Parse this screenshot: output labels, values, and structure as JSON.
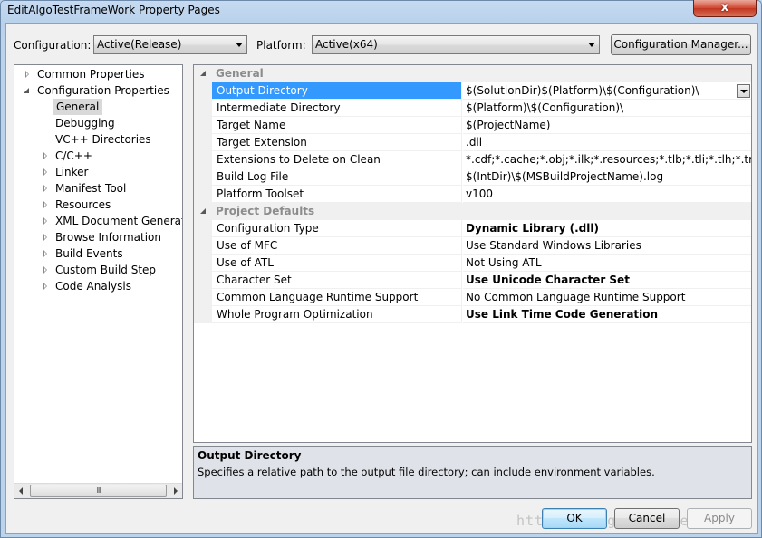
{
  "window": {
    "title": "EditAlgoTestFrameWork Property Pages",
    "close_glyph": "x"
  },
  "toolbar": {
    "configuration_label": "Configuration:",
    "configuration_value": "Active(Release)",
    "platform_label": "Platform:",
    "platform_value": "Active(x64)",
    "config_manager_button": "Configuration Manager..."
  },
  "tree": {
    "items": [
      {
        "label": "Common Properties",
        "level": 0,
        "expander": "collapsed"
      },
      {
        "label": "Configuration Properties",
        "level": 0,
        "expander": "expanded"
      },
      {
        "label": "General",
        "level": 1,
        "expander": "none",
        "selected": true
      },
      {
        "label": "Debugging",
        "level": 1,
        "expander": "none"
      },
      {
        "label": "VC++ Directories",
        "level": 1,
        "expander": "none"
      },
      {
        "label": "C/C++",
        "level": 1,
        "expander": "collapsed"
      },
      {
        "label": "Linker",
        "level": 1,
        "expander": "collapsed"
      },
      {
        "label": "Manifest Tool",
        "level": 1,
        "expander": "collapsed"
      },
      {
        "label": "Resources",
        "level": 1,
        "expander": "collapsed"
      },
      {
        "label": "XML Document Generator",
        "level": 1,
        "expander": "collapsed"
      },
      {
        "label": "Browse Information",
        "level": 1,
        "expander": "collapsed"
      },
      {
        "label": "Build Events",
        "level": 1,
        "expander": "collapsed"
      },
      {
        "label": "Custom Build Step",
        "level": 1,
        "expander": "collapsed"
      },
      {
        "label": "Code Analysis",
        "level": 1,
        "expander": "collapsed"
      }
    ],
    "scroll_thumb_grip": "III"
  },
  "grid": {
    "categories": [
      {
        "name": "General",
        "rows": [
          {
            "name": "Output Directory",
            "value": "$(SolutionDir)$(Platform)\\$(Configuration)\\",
            "selected": true
          },
          {
            "name": "Intermediate Directory",
            "value": "$(Platform)\\$(Configuration)\\"
          },
          {
            "name": "Target Name",
            "value": "$(ProjectName)"
          },
          {
            "name": "Target Extension",
            "value": ".dll"
          },
          {
            "name": "Extensions to Delete on Clean",
            "value": "*.cdf;*.cache;*.obj;*.ilk;*.resources;*.tlb;*.tli;*.tlh;*.tmp;*.rsp;*.pgc;*.pgd;*.meta;*.tlog;*.manifest;*.res;*.pch;*.exp;*.idb;*.rep;*.xdc;*.pdb;*_manifest.rc;*.bsc;*.sbr;*.xml;*.metagen;*.bi"
          },
          {
            "name": "Build Log File",
            "value": "$(IntDir)\\$(MSBuildProjectName).log"
          },
          {
            "name": "Platform Toolset",
            "value": "v100"
          }
        ]
      },
      {
        "name": "Project Defaults",
        "rows": [
          {
            "name": "Configuration Type",
            "value": "Dynamic Library (.dll)",
            "bold": true
          },
          {
            "name": "Use of MFC",
            "value": "Use Standard Windows Libraries"
          },
          {
            "name": "Use of ATL",
            "value": "Not Using ATL"
          },
          {
            "name": "Character Set",
            "value": "Use Unicode Character Set",
            "bold": true
          },
          {
            "name": "Common Language Runtime Support",
            "value": "No Common Language Runtime Support"
          },
          {
            "name": "Whole Program Optimization",
            "value": "Use Link Time Code Generation",
            "bold": true
          }
        ]
      }
    ]
  },
  "description": {
    "title": "Output Directory",
    "text": "Specifies a relative path to the output file directory; can include environment variables."
  },
  "buttons": {
    "ok": "OK",
    "cancel": "Cancel",
    "apply": "Apply"
  },
  "watermark": "http://blog.csdn.net/"
}
